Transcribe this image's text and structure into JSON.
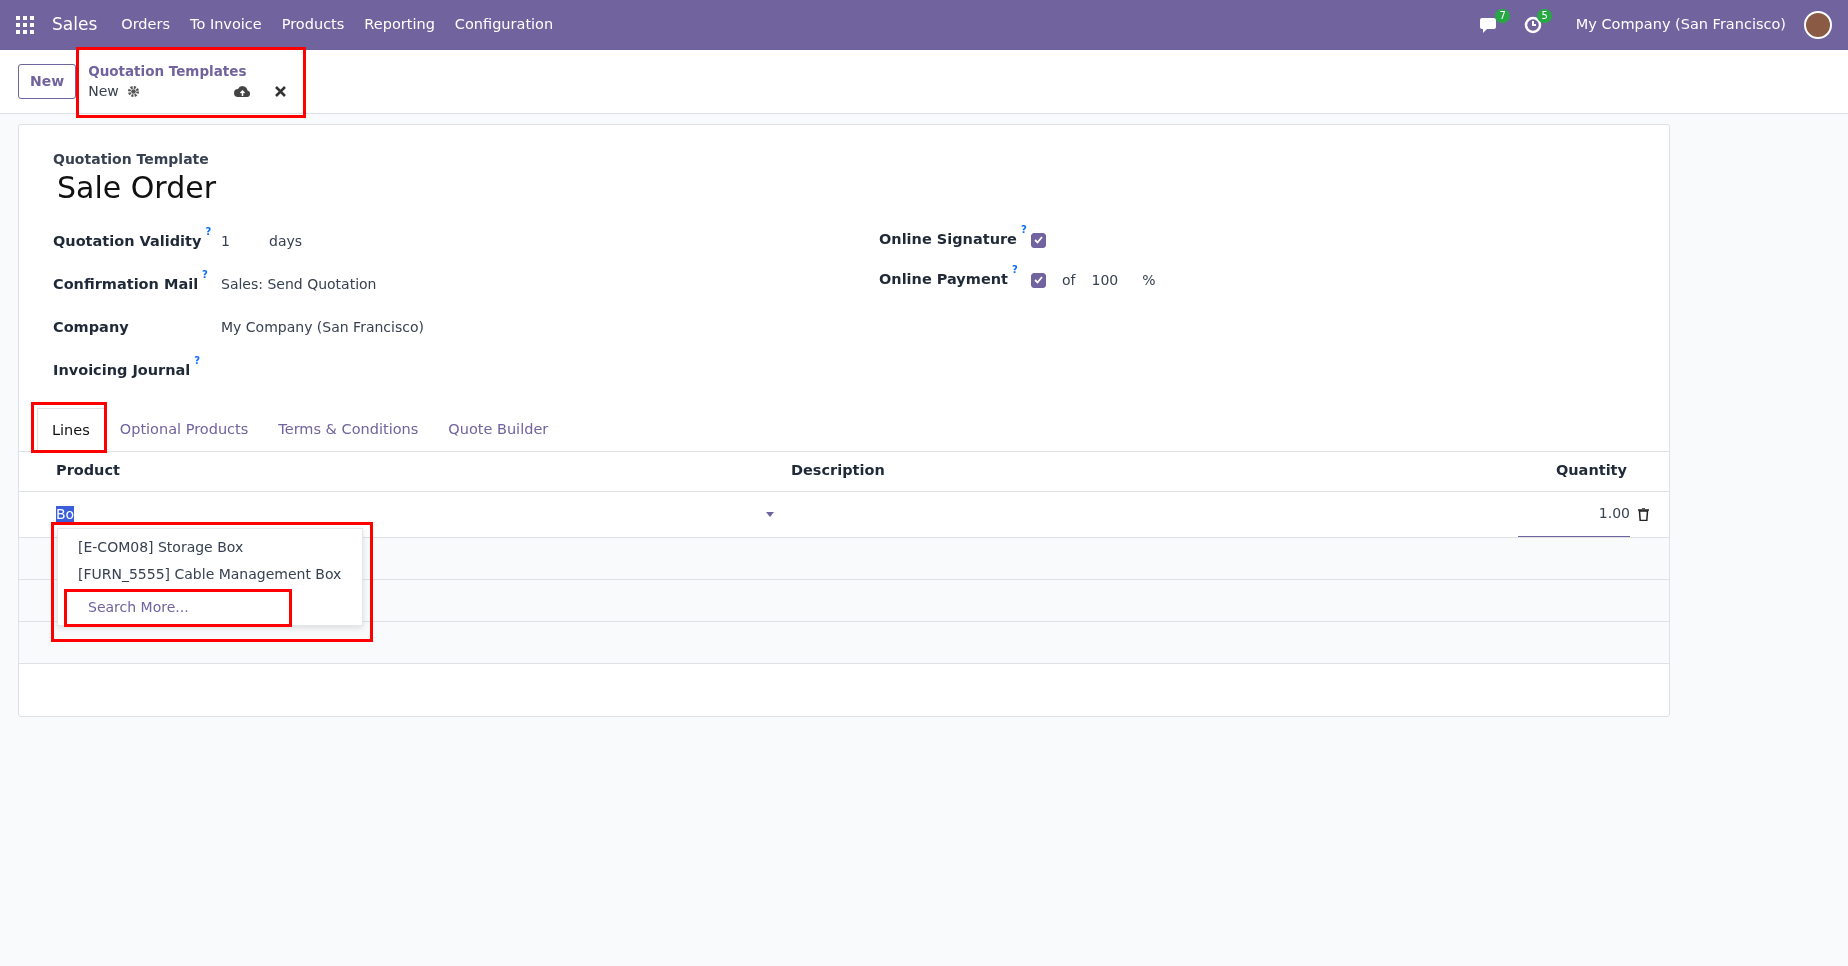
{
  "navbar": {
    "app": "Sales",
    "menu": [
      "Orders",
      "To Invoice",
      "Products",
      "Reporting",
      "Configuration"
    ],
    "messages_count": "7",
    "activities_count": "5",
    "company": "My Company (San Francisco)"
  },
  "control_panel": {
    "new_button": "New",
    "breadcrumb": "Quotation Templates",
    "record": "New",
    "highlighted": true
  },
  "form": {
    "template_label": "Quotation Template",
    "name": "Sale Order",
    "left_fields": [
      {
        "label": "Quotation Validity",
        "help": "?",
        "value": "1",
        "unit": "days"
      },
      {
        "label": "Confirmation Mail",
        "help": "?",
        "value": "Sales: Send Quotation"
      },
      {
        "label": "Company",
        "value": "My Company (San Francisco)"
      },
      {
        "label": "Invoicing Journal",
        "help": "?"
      }
    ],
    "right_fields": [
      {
        "label": "Online Signature",
        "help": "?",
        "checked": true
      },
      {
        "label": "Online Payment",
        "help": "?",
        "checked": true,
        "prefix": "of",
        "value": "100",
        "unit": "%"
      }
    ]
  },
  "tabs": [
    {
      "label": "Lines",
      "selected": true,
      "highlighted": true
    },
    {
      "label": "Optional Products",
      "selected": false,
      "highlighted": false
    },
    {
      "label": "Terms & Conditions",
      "selected": false,
      "highlighted": false
    },
    {
      "label": "Quote Builder",
      "selected": false,
      "highlighted": false
    }
  ],
  "lines": {
    "columns": [
      "Product",
      "Description",
      "Quantity"
    ],
    "product_input": "Bo",
    "text_selected": true,
    "quantity": "1.00"
  },
  "dropdown": {
    "highlighted": true,
    "items": [
      "[E-COM08] Storage Box",
      "[FURN_5555] Cable Management Box"
    ],
    "search_more": "Search More...",
    "search_more_highlighted": true
  }
}
